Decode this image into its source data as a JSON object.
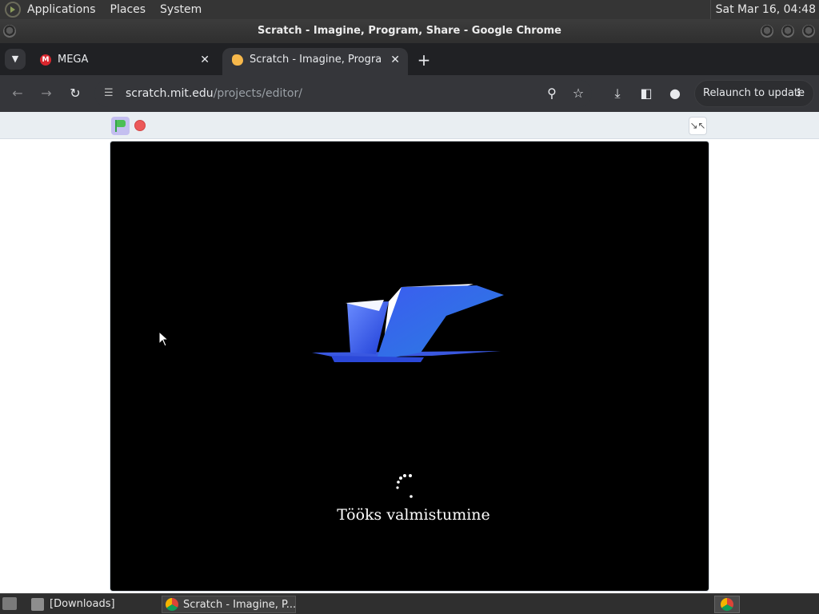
{
  "system_panel": {
    "menus": [
      "Applications",
      "Places",
      "System"
    ],
    "clock": "Sat Mar 16, 04:48"
  },
  "window": {
    "title": "Scratch - Imagine, Program, Share - Google Chrome"
  },
  "tabs": [
    {
      "label": "MEGA",
      "active": false,
      "favicon": "mega-icon"
    },
    {
      "label": "Scratch - Imagine, Program, Share",
      "active": true,
      "favicon": "scratch-cat-icon"
    }
  ],
  "toolbar": {
    "url_host": "scratch.mit.edu",
    "url_path": "/projects/editor/",
    "relaunch_label": "Relaunch to update"
  },
  "scratch": {
    "loading_text": "Tööks valmistumine"
  },
  "taskbar": {
    "items": [
      {
        "label": "[Downloads]",
        "active": false,
        "icon": "folder-icon"
      },
      {
        "label": "Scratch - Imagine, P...",
        "active": true,
        "icon": "chrome-icon"
      }
    ]
  },
  "colors": {
    "stage_bg": "#000000",
    "browser_chrome": "#35363a",
    "tab_strip": "#202124",
    "controls_bar": "#e9eef2"
  }
}
